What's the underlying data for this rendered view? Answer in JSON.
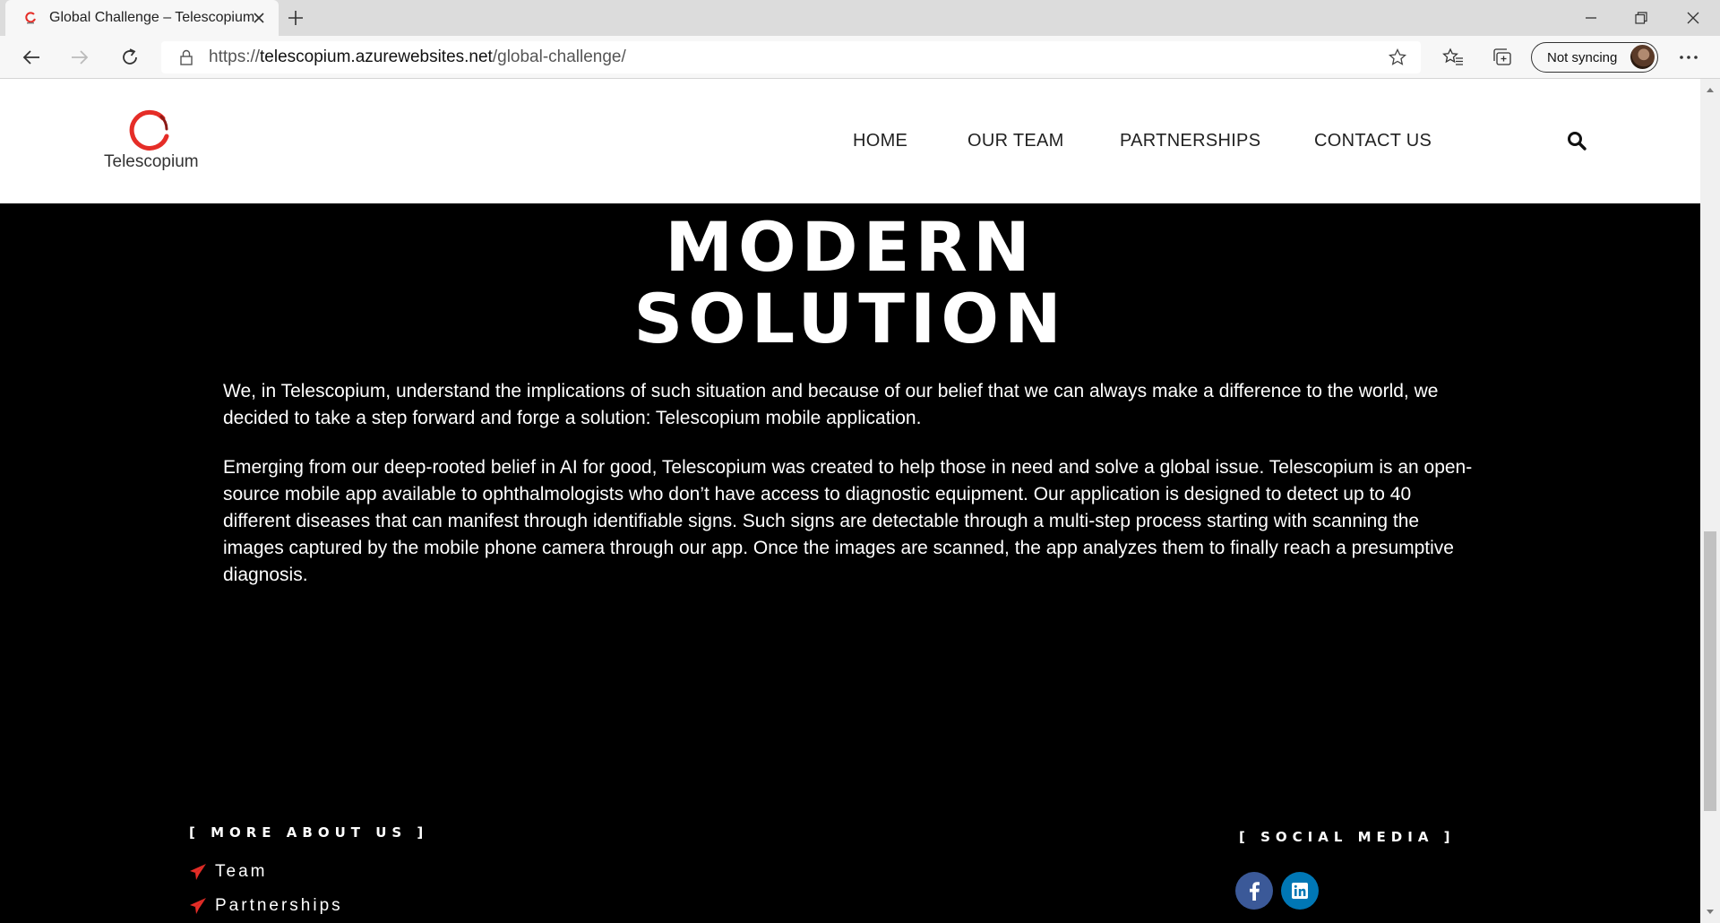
{
  "browser": {
    "tab_title": "Global Challenge – Telescopium",
    "url_scheme": "https://",
    "url_host": "telescopium.azurewebsites.net",
    "url_path": "/global-challenge/",
    "sync_label": "Not syncing"
  },
  "header": {
    "logo_text": "Telescopium",
    "nav": [
      "HOME",
      "OUR TEAM",
      "PARTNERSHIPS",
      "CONTACT US"
    ]
  },
  "hero": {
    "title_line1": "MODERN",
    "title_line2": "SOLUTION"
  },
  "content": {
    "paragraph1": "We, in Telescopium, understand the implications of such situation and because of our belief that we can always make a difference to the world, we decided to take a step forward and forge a solution: Telescopium mobile application.",
    "paragraph2": "Emerging from our deep-rooted belief in AI for good, Telescopium was created to help those in need and solve a global issue. Telescopium is an open-source mobile app available to ophthalmologists who don’t have access to diagnostic equipment. Our application is designed to detect up to 40 different diseases that can manifest through identifiable signs. Such signs are detectable through a multi-step process starting with scanning the images captured by the mobile phone camera through our app. Once the images are scanned, the app analyzes them to finally reach a presumptive diagnosis."
  },
  "footer": {
    "more_heading": "[ MORE ABOUT US ]",
    "links": [
      "Team",
      "Partnerships"
    ],
    "social_heading": "[ SOCIAL MEDIA ]"
  },
  "colors": {
    "accent_red": "#e52d27",
    "facebook": "#3b5998",
    "linkedin": "#0077b5"
  },
  "icons": [
    "telescopium-favicon",
    "close-icon",
    "plus-icon",
    "minimize-icon",
    "restore-icon",
    "window-close-icon",
    "back-arrow-icon",
    "forward-arrow-icon",
    "refresh-icon",
    "lock-icon",
    "star-icon",
    "favorites-icon",
    "collections-icon",
    "more-icon",
    "search-icon",
    "paper-plane-icon",
    "facebook-icon",
    "linkedin-icon"
  ]
}
